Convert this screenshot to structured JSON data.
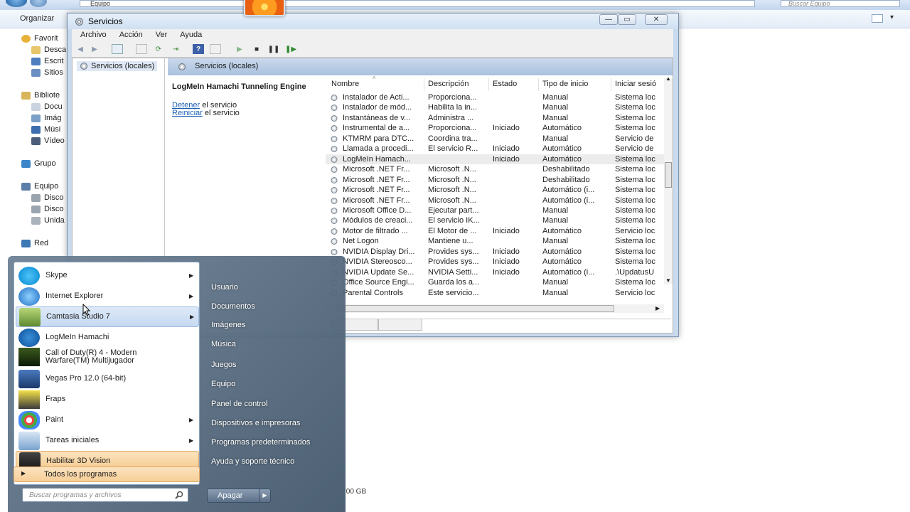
{
  "explorer": {
    "breadcrumb": "Equipo",
    "search_placeholder": "Buscar Equipo",
    "organize": "Organizar",
    "nav": [
      {
        "label": "Favorit",
        "icon": "star-icon",
        "sub": false
      },
      {
        "label": "Desca",
        "icon": "folder-icon",
        "sub": true
      },
      {
        "label": "Escrit",
        "icon": "desktop-icon",
        "sub": true
      },
      {
        "label": "Sitios",
        "icon": "places-icon",
        "sub": true
      },
      {
        "label": "Bibliote",
        "icon": "library-icon",
        "sub": false
      },
      {
        "label": "Docu",
        "icon": "documents-icon",
        "sub": true
      },
      {
        "label": "Imág",
        "icon": "pictures-icon",
        "sub": true
      },
      {
        "label": "Músi",
        "icon": "music-icon",
        "sub": true
      },
      {
        "label": "Vídeo",
        "icon": "video-icon",
        "sub": true
      },
      {
        "label": "Grupo",
        "icon": "homegroup-icon",
        "sub": false
      },
      {
        "label": "Equipo",
        "icon": "computer-icon",
        "sub": false
      },
      {
        "label": "Disco",
        "icon": "disk-icon",
        "sub": true
      },
      {
        "label": "Disco",
        "icon": "disk-icon",
        "sub": true
      },
      {
        "label": "Unida",
        "icon": "drive-icon",
        "sub": true
      },
      {
        "label": "Red",
        "icon": "network-icon",
        "sub": false
      }
    ],
    "status_size": ",00 GB"
  },
  "services": {
    "title": "Servicios",
    "menu": [
      "Archivo",
      "Acción",
      "Ver",
      "Ayuda"
    ],
    "tree_item": "Servicios (locales)",
    "header": "Servicios (locales)",
    "detail": {
      "name": "LogMeIn Hamachi Tunneling Engine",
      "stop_link": "Detener",
      "stop_rest": " el servicio",
      "restart_link": "Reiniciar",
      "restart_rest": " el servicio"
    },
    "columns": [
      "Nombre",
      "Descripción",
      "Estado",
      "Tipo de inicio",
      "Iniciar sesió"
    ],
    "rows": [
      [
        "Instalador de Acti...",
        "Proporciona...",
        "",
        "Manual",
        "Sistema loc"
      ],
      [
        "Instalador de mód...",
        "Habilita la in...",
        "",
        "Manual",
        "Sistema loc"
      ],
      [
        "Instantáneas de v...",
        "Administra ...",
        "",
        "Manual",
        "Sistema loc"
      ],
      [
        "Instrumental de a...",
        "Proporciona...",
        "Iniciado",
        "Automático",
        "Sistema loc"
      ],
      [
        "KTMRM para DTC...",
        "Coordina tra...",
        "",
        "Manual",
        "Servicio de"
      ],
      [
        "Llamada a procedi...",
        "El servicio R...",
        "Iniciado",
        "Automático",
        "Servicio de"
      ],
      [
        "LogMeIn Hamach...",
        "",
        "Iniciado",
        "Automático",
        "Sistema loc"
      ],
      [
        "Microsoft .NET Fr...",
        "Microsoft .N...",
        "",
        "Deshabilitado",
        "Sistema loc"
      ],
      [
        "Microsoft .NET Fr...",
        "Microsoft .N...",
        "",
        "Deshabilitado",
        "Sistema loc"
      ],
      [
        "Microsoft .NET Fr...",
        "Microsoft .N...",
        "",
        "Automático (i...",
        "Sistema loc"
      ],
      [
        "Microsoft .NET Fr...",
        "Microsoft .N...",
        "",
        "Automático (i...",
        "Sistema loc"
      ],
      [
        "Microsoft Office D...",
        "Ejecutar part...",
        "",
        "Manual",
        "Sistema loc"
      ],
      [
        "Módulos de creaci...",
        "El servicio IK...",
        "",
        "Manual",
        "Sistema loc"
      ],
      [
        "Motor de filtrado ...",
        "El Motor de ...",
        "Iniciado",
        "Automático",
        "Servicio loc"
      ],
      [
        "Net Logon",
        "Mantiene u...",
        "",
        "Manual",
        "Sistema loc"
      ],
      [
        "NVIDIA Display Dri...",
        "Provides sys...",
        "Iniciado",
        "Automático",
        "Sistema loc"
      ],
      [
        "NVIDIA Stereosco...",
        "Provides sys...",
        "Iniciado",
        "Automático",
        "Sistema loc"
      ],
      [
        "NVIDIA Update Se...",
        "NVIDIA Setti...",
        "Iniciado",
        "Automático (i...",
        ".\\UpdatusU"
      ],
      [
        "Office Source Engi...",
        "Guarda los a...",
        "",
        "Manual",
        "Sistema loc"
      ],
      [
        "Parental Controls",
        "Este servicio...",
        "",
        "Manual",
        "Servicio loc"
      ]
    ],
    "selected_row": 6
  },
  "startmenu": {
    "programs": [
      {
        "label": "Skype",
        "icon": "skype-icon",
        "arrow": true,
        "state": ""
      },
      {
        "label": "Internet Explorer",
        "icon": "internet-explorer-icon",
        "arrow": true,
        "state": ""
      },
      {
        "label": "Camtasia Studio 7",
        "icon": "camtasia-icon",
        "arrow": true,
        "state": "hover"
      },
      {
        "label": "LogMeIn Hamachi",
        "icon": "hamachi-icon",
        "arrow": false,
        "state": ""
      },
      {
        "label": "Call of Duty(R) 4 - Modern",
        "label2": "Warfare(TM) Multijugador",
        "icon": "call-of-duty-icon",
        "arrow": false,
        "state": ""
      },
      {
        "label": "Vegas Pro 12.0 (64-bit)",
        "icon": "vegas-pro-icon",
        "arrow": false,
        "state": ""
      },
      {
        "label": "Fraps",
        "icon": "fraps-icon",
        "arrow": false,
        "state": ""
      },
      {
        "label": "Paint",
        "icon": "paint-icon",
        "arrow": true,
        "state": ""
      },
      {
        "label": "Tareas iniciales",
        "icon": "getting-started-icon",
        "arrow": true,
        "state": ""
      },
      {
        "label": "Habilitar 3D Vision",
        "icon": "3d-vision-icon",
        "arrow": false,
        "state": "highlight"
      }
    ],
    "all_programs": "Todos los programas",
    "search_placeholder": "Buscar programas y archivos",
    "right_links": [
      "Usuario",
      "Documentos",
      "Imágenes",
      "Música",
      "Juegos",
      "Equipo",
      "Panel de control",
      "Dispositivos e impresoras",
      "Programas predeterminados",
      "Ayuda y soporte técnico"
    ],
    "shutdown": "Apagar"
  },
  "colors": {
    "accent": "#1a5fb4",
    "highlight": "#f6c98c",
    "startmenu": "#5c7089"
  }
}
